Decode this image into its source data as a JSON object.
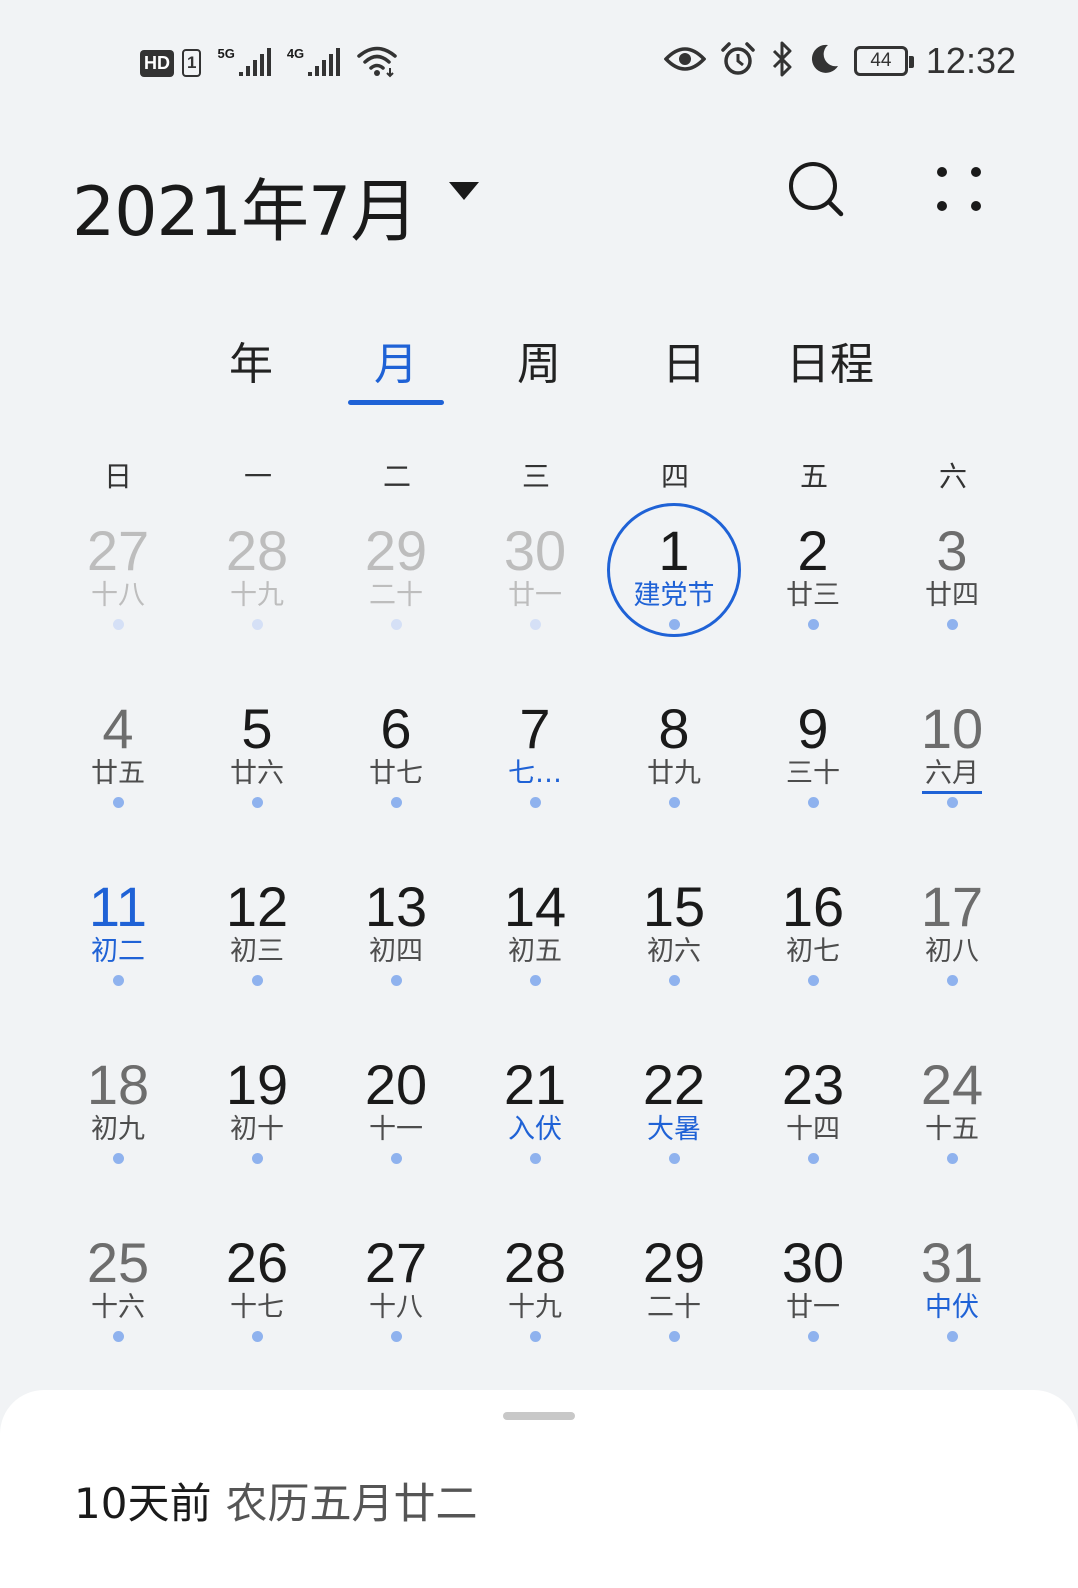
{
  "status_bar": {
    "hd": "HD",
    "sim": "1",
    "net1": "5G",
    "net2": "4G",
    "battery": "44",
    "time": "12:32"
  },
  "header": {
    "title": "2021年7月"
  },
  "tabs": [
    "年",
    "月",
    "周",
    "日",
    "日程"
  ],
  "active_tab": "月",
  "weekdays": [
    "日",
    "一",
    "二",
    "三",
    "四",
    "五",
    "六"
  ],
  "calendar": {
    "weeks": [
      [
        {
          "day": "27",
          "lunar": "十八",
          "other": true
        },
        {
          "day": "28",
          "lunar": "十九",
          "other": true
        },
        {
          "day": "29",
          "lunar": "二十",
          "other": true
        },
        {
          "day": "30",
          "lunar": "廿一",
          "other": true
        },
        {
          "day": "1",
          "lunar": "建党节",
          "holiday": true,
          "today": true
        },
        {
          "day": "2",
          "lunar": "廿三"
        },
        {
          "day": "3",
          "lunar": "廿四"
        }
      ],
      [
        {
          "day": "4",
          "lunar": "廿五"
        },
        {
          "day": "5",
          "lunar": "廿六"
        },
        {
          "day": "6",
          "lunar": "廿七"
        },
        {
          "day": "7",
          "lunar": "七…",
          "holiday": true
        },
        {
          "day": "8",
          "lunar": "廿九"
        },
        {
          "day": "9",
          "lunar": "三十"
        },
        {
          "day": "10",
          "lunar": "六月",
          "underline": true
        }
      ],
      [
        {
          "day": "11",
          "lunar": "初二",
          "holiday": true,
          "blue_num": true
        },
        {
          "day": "12",
          "lunar": "初三"
        },
        {
          "day": "13",
          "lunar": "初四"
        },
        {
          "day": "14",
          "lunar": "初五"
        },
        {
          "day": "15",
          "lunar": "初六"
        },
        {
          "day": "16",
          "lunar": "初七"
        },
        {
          "day": "17",
          "lunar": "初八"
        }
      ],
      [
        {
          "day": "18",
          "lunar": "初九"
        },
        {
          "day": "19",
          "lunar": "初十"
        },
        {
          "day": "20",
          "lunar": "十一"
        },
        {
          "day": "21",
          "lunar": "入伏",
          "holiday": true
        },
        {
          "day": "22",
          "lunar": "大暑",
          "holiday": true
        },
        {
          "day": "23",
          "lunar": "十四"
        },
        {
          "day": "24",
          "lunar": "十五"
        }
      ],
      [
        {
          "day": "25",
          "lunar": "十六"
        },
        {
          "day": "26",
          "lunar": "十七"
        },
        {
          "day": "27",
          "lunar": "十八"
        },
        {
          "day": "28",
          "lunar": "十九"
        },
        {
          "day": "29",
          "lunar": "二十"
        },
        {
          "day": "30",
          "lunar": "廿一"
        },
        {
          "day": "31",
          "lunar": "中伏",
          "holiday": true
        }
      ]
    ]
  },
  "sheet": {
    "relative": "10天前",
    "lunar_date": "农历五月廿二"
  },
  "colors": {
    "accent": "#1f62d6",
    "background": "#f1f3f5",
    "dot": "#8fb2ee"
  }
}
